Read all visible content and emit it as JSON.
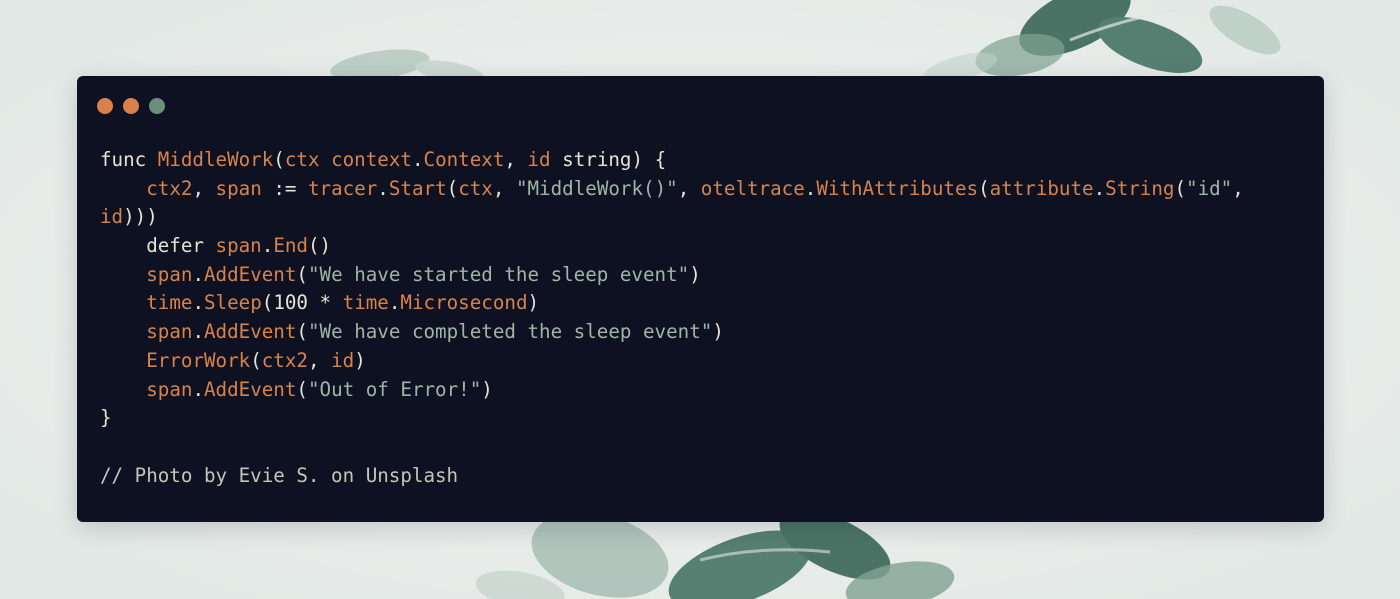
{
  "window": {
    "buttons": [
      {
        "name": "close",
        "color": "#d9814a"
      },
      {
        "name": "minimize",
        "color": "#d9814a"
      },
      {
        "name": "zoom",
        "color": "#6b8f7b"
      }
    ]
  },
  "colors": {
    "background": "#e9eeec",
    "panel": "#0d1122",
    "text": "#e7e3d4",
    "accent": "#d8834a",
    "string": "#9fb5a6",
    "leaf": "#2f5f4f"
  },
  "code": {
    "lines": [
      [
        {
          "t": "func ",
          "c": "kw"
        },
        {
          "t": "MiddleWork",
          "c": "fn"
        },
        {
          "t": "(",
          "c": "pl"
        },
        {
          "t": "ctx",
          "c": "id"
        },
        {
          "t": " ",
          "c": "pl"
        },
        {
          "t": "context",
          "c": "id"
        },
        {
          "t": ".",
          "c": "pl"
        },
        {
          "t": "Context",
          "c": "fn"
        },
        {
          "t": ", ",
          "c": "pl"
        },
        {
          "t": "id",
          "c": "id"
        },
        {
          "t": " string) {",
          "c": "pl"
        }
      ],
      [
        {
          "t": "    ",
          "c": "pl"
        },
        {
          "t": "ctx2",
          "c": "id"
        },
        {
          "t": ", ",
          "c": "pl"
        },
        {
          "t": "span",
          "c": "id"
        },
        {
          "t": " := ",
          "c": "pl"
        },
        {
          "t": "tracer",
          "c": "id"
        },
        {
          "t": ".",
          "c": "pl"
        },
        {
          "t": "Start",
          "c": "fn"
        },
        {
          "t": "(",
          "c": "pl"
        },
        {
          "t": "ctx",
          "c": "id"
        },
        {
          "t": ", ",
          "c": "pl"
        },
        {
          "t": "\"MiddleWork()\"",
          "c": "str"
        },
        {
          "t": ", ",
          "c": "pl"
        },
        {
          "t": "oteltrace",
          "c": "id"
        },
        {
          "t": ".",
          "c": "pl"
        },
        {
          "t": "WithAttributes",
          "c": "fn"
        },
        {
          "t": "(",
          "c": "pl"
        },
        {
          "t": "attribute",
          "c": "id"
        },
        {
          "t": ".",
          "c": "pl"
        },
        {
          "t": "String",
          "c": "fn"
        },
        {
          "t": "(",
          "c": "pl"
        },
        {
          "t": "\"id\"",
          "c": "str"
        },
        {
          "t": ",",
          "c": "pl"
        }
      ],
      [
        {
          "t": "id",
          "c": "id"
        },
        {
          "t": ")))",
          "c": "pl"
        }
      ],
      [
        {
          "t": "    defer ",
          "c": "kw"
        },
        {
          "t": "span",
          "c": "id"
        },
        {
          "t": ".",
          "c": "pl"
        },
        {
          "t": "End",
          "c": "fn"
        },
        {
          "t": "()",
          "c": "pl"
        }
      ],
      [
        {
          "t": "    ",
          "c": "pl"
        },
        {
          "t": "span",
          "c": "id"
        },
        {
          "t": ".",
          "c": "pl"
        },
        {
          "t": "AddEvent",
          "c": "fn"
        },
        {
          "t": "(",
          "c": "pl"
        },
        {
          "t": "\"We have started the sleep event\"",
          "c": "str"
        },
        {
          "t": ")",
          "c": "pl"
        }
      ],
      [
        {
          "t": "    ",
          "c": "pl"
        },
        {
          "t": "time",
          "c": "id"
        },
        {
          "t": ".",
          "c": "pl"
        },
        {
          "t": "Sleep",
          "c": "fn"
        },
        {
          "t": "(100 * ",
          "c": "pl"
        },
        {
          "t": "time",
          "c": "id"
        },
        {
          "t": ".",
          "c": "pl"
        },
        {
          "t": "Microsecond",
          "c": "fn"
        },
        {
          "t": ")",
          "c": "pl"
        }
      ],
      [
        {
          "t": "    ",
          "c": "pl"
        },
        {
          "t": "span",
          "c": "id"
        },
        {
          "t": ".",
          "c": "pl"
        },
        {
          "t": "AddEvent",
          "c": "fn"
        },
        {
          "t": "(",
          "c": "pl"
        },
        {
          "t": "\"We have completed the sleep event\"",
          "c": "str"
        },
        {
          "t": ")",
          "c": "pl"
        }
      ],
      [
        {
          "t": "    ",
          "c": "pl"
        },
        {
          "t": "ErrorWork",
          "c": "fn"
        },
        {
          "t": "(",
          "c": "pl"
        },
        {
          "t": "ctx2",
          "c": "id"
        },
        {
          "t": ", ",
          "c": "pl"
        },
        {
          "t": "id",
          "c": "id"
        },
        {
          "t": ")",
          "c": "pl"
        }
      ],
      [
        {
          "t": "    ",
          "c": "pl"
        },
        {
          "t": "span",
          "c": "id"
        },
        {
          "t": ".",
          "c": "pl"
        },
        {
          "t": "AddEvent",
          "c": "fn"
        },
        {
          "t": "(",
          "c": "pl"
        },
        {
          "t": "\"Out of Error!\"",
          "c": "str"
        },
        {
          "t": ")",
          "c": "pl"
        }
      ],
      [
        {
          "t": "}",
          "c": "pl"
        }
      ],
      [],
      [
        {
          "t": "// Photo by Evie S. on Unsplash",
          "c": "cm"
        }
      ]
    ]
  }
}
